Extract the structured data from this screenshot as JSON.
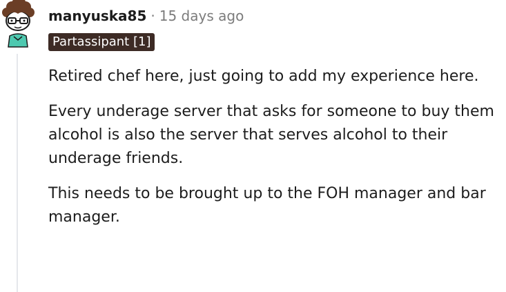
{
  "comment": {
    "username": "manyuska85",
    "separator": "·",
    "timestamp": "15 days ago",
    "flair": "Partassipant [1]",
    "paragraphs": [
      "Retired chef here, just going to add my experience here.",
      "Every underage server that asks for someone to buy them alcohol is also the server that serves alcohol to their underage friends.",
      "This needs to be brought up to the FOH manager and bar manager."
    ]
  },
  "colors": {
    "flair_background": "#3d2b25",
    "flair_text": "#ffffff",
    "meta_text": "#7c7c7c",
    "body_text": "#1c1c1c",
    "thread_line": "#e5e7eb"
  }
}
